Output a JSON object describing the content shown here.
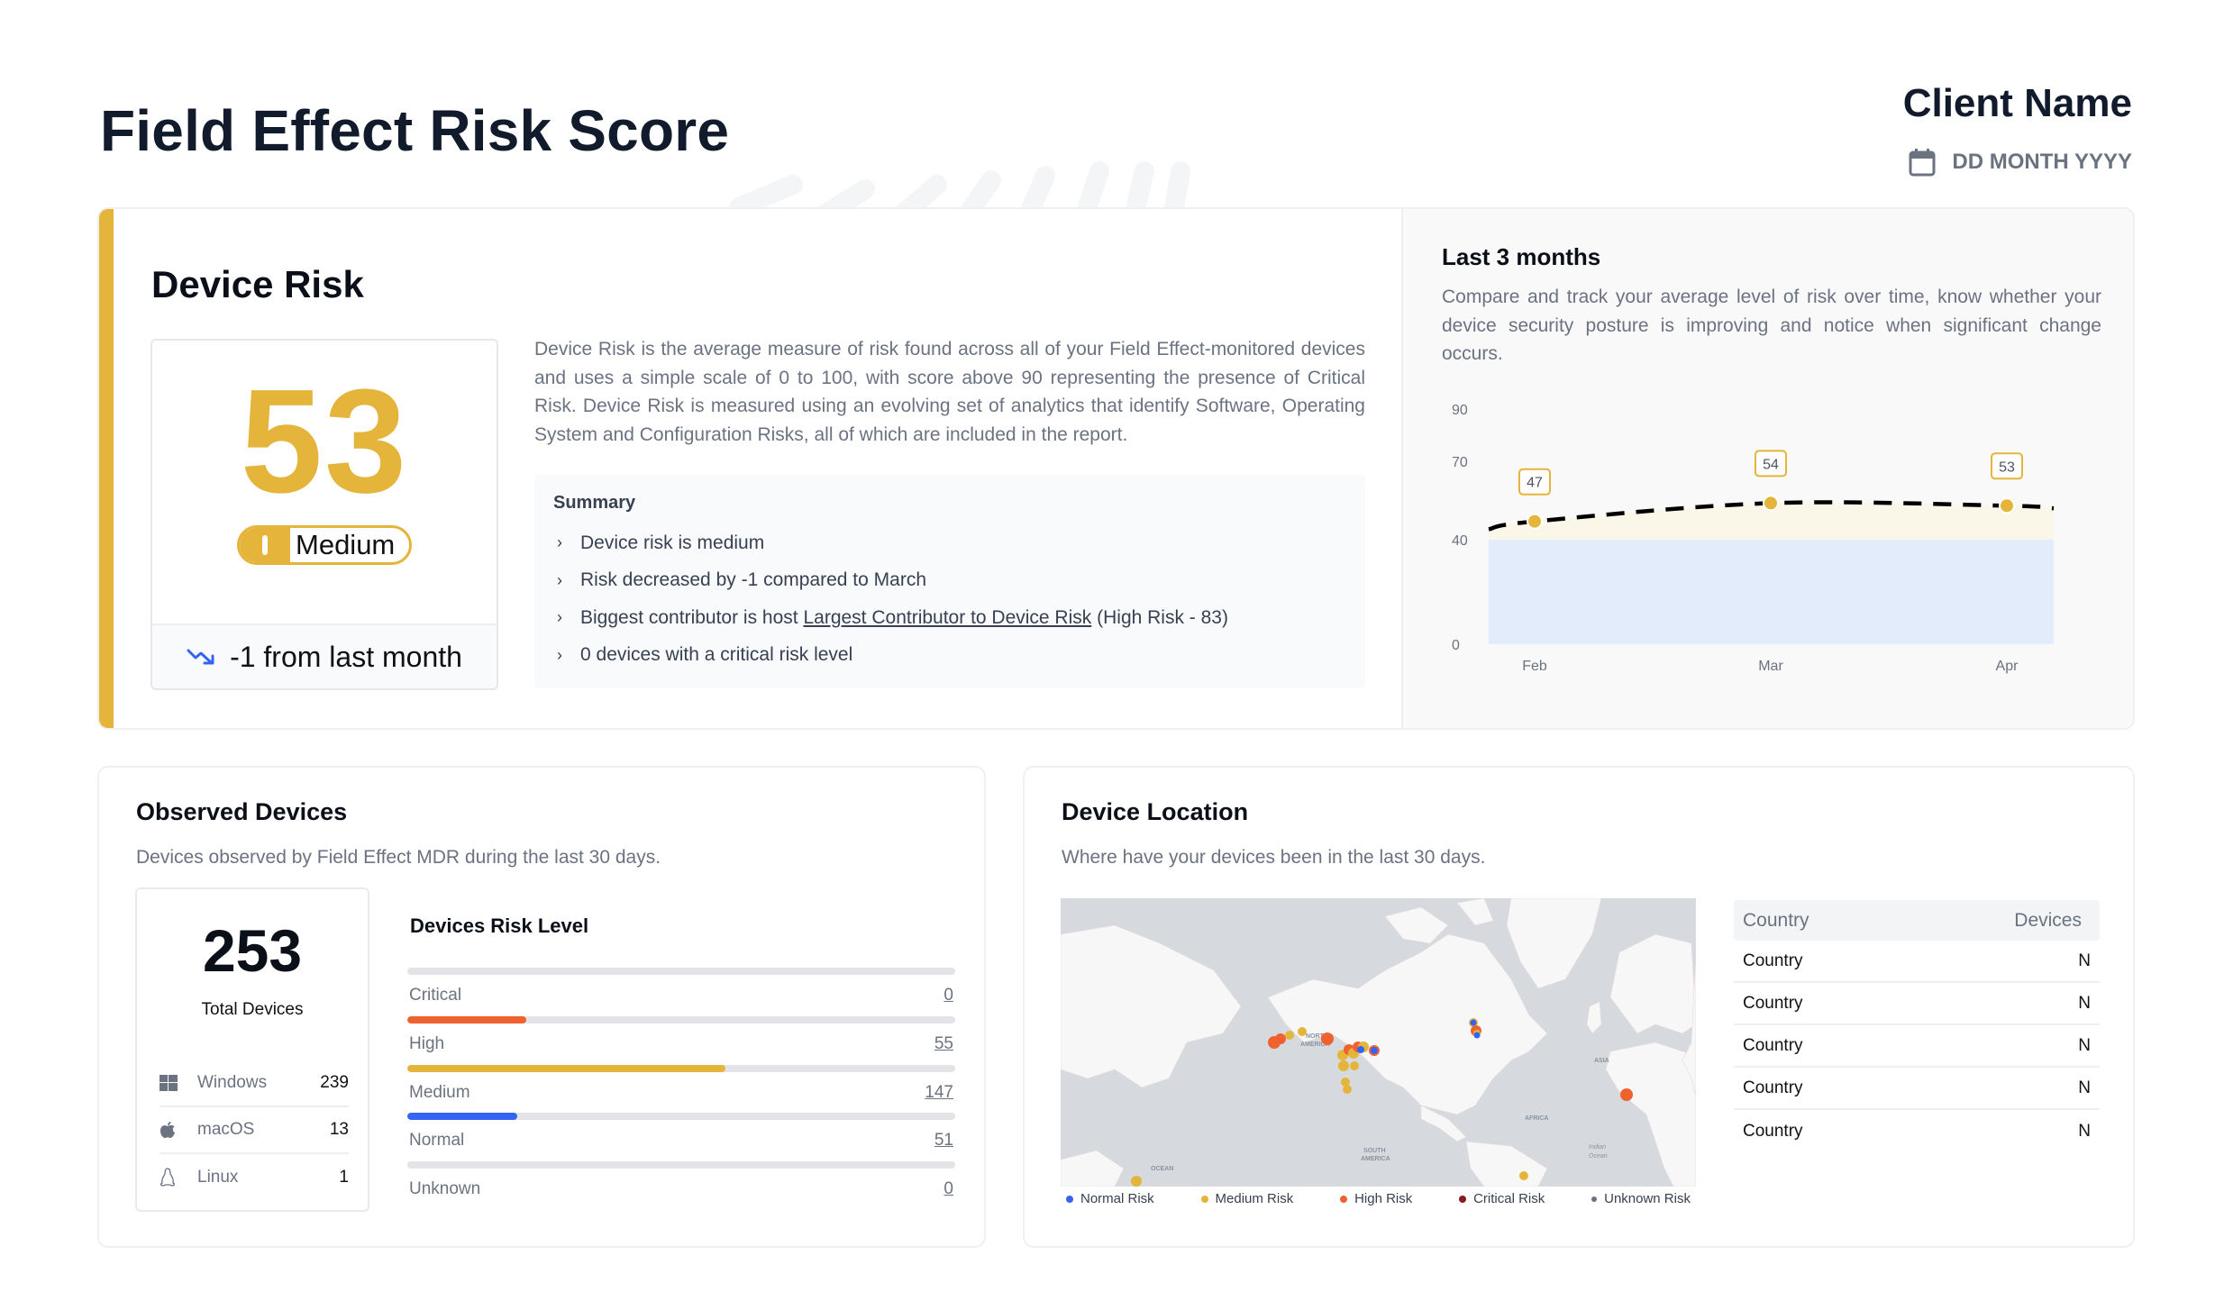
{
  "header": {
    "title": "Field Effect Risk Score",
    "client_name": "Client Name",
    "date": "DD MONTH YYYY",
    "date_icon": "calendar-icon"
  },
  "colors": {
    "accent_gold": "#e5b43a",
    "high_orange": "#f06130",
    "normal_blue": "#3563f3",
    "critical_red": "#8b1a1a",
    "unknown_gray": "#6b7280",
    "band_blue": "#e3ecfb",
    "band_cream": "#faf6e8"
  },
  "device_risk": {
    "title": "Device Risk",
    "score": "53",
    "level": "Medium",
    "trend_icon": "trending-down-icon",
    "change_text": "-1 from last month",
    "description": "Device Risk is the average measure of risk found across all of your Field Effect-monitored devices and uses a simple scale of 0 to 100, with score above 90 representing the presence of Critical Risk. Device Risk is measured using an evolving set of analytics that identify Software, Operating System and Configuration Risks, all of which are included in the report.",
    "summary": {
      "title": "Summary",
      "items": [
        {
          "text": "Device risk is medium"
        },
        {
          "text": "Risk decreased by -1 compared to March"
        },
        {
          "prefix": "Biggest contributor is host ",
          "link": "Largest Contributor to Device Risk",
          "suffix": " (High Risk - 83)"
        },
        {
          "text": "0 devices with a critical risk level"
        }
      ]
    }
  },
  "last_3_months": {
    "title": "Last 3 months",
    "description": "Compare and track your average level of risk over time, know whether your device security posture is improving and notice when significant change occurs."
  },
  "chart_data": {
    "type": "line",
    "title": "Last 3 months",
    "categories": [
      "Feb",
      "Mar",
      "Apr"
    ],
    "series": [
      {
        "name": "Device Risk",
        "values": [
          47,
          54,
          53
        ],
        "style": "dashed",
        "marker_color": "#e5b43a"
      }
    ],
    "data_labels": [
      "47",
      "54",
      "53"
    ],
    "y_ticks": [
      0,
      40,
      70,
      90
    ],
    "y_tick_labels": [
      "0",
      "40",
      "70",
      "90"
    ],
    "ylim": [
      0,
      90
    ],
    "bands": [
      {
        "from": 0,
        "to": 40,
        "label": "normal",
        "color": "#e3ecfb"
      },
      {
        "from": 40,
        "to": "line",
        "label": "medium",
        "color": "#faf6e8"
      }
    ],
    "extends_before_first": 44,
    "extends_after_last": 52,
    "xlabel": "",
    "ylabel": "",
    "grid": false,
    "legend": "none"
  },
  "observed_devices": {
    "title": "Observed Devices",
    "subtitle": "Devices observed by Field Effect MDR during the last 30 days.",
    "total": "253",
    "total_label": "Total Devices",
    "os": [
      {
        "name": "Windows",
        "count": "239",
        "icon": "windows-icon"
      },
      {
        "name": "macOS",
        "count": "13",
        "icon": "apple-icon"
      },
      {
        "name": "Linux",
        "count": "1",
        "icon": "linux-icon"
      }
    ],
    "risk_level_title": "Devices Risk Level",
    "risk_levels": [
      {
        "label": "Critical",
        "value": "0",
        "fraction": 0,
        "color": "#8b1a1a"
      },
      {
        "label": "High",
        "value": "55",
        "fraction": 0.217,
        "color": "#f06130"
      },
      {
        "label": "Medium",
        "value": "147",
        "fraction": 0.581,
        "color": "#e5b43a"
      },
      {
        "label": "Normal",
        "value": "51",
        "fraction": 0.2,
        "color": "#3563f3"
      },
      {
        "label": "Unknown",
        "value": "0",
        "fraction": 0,
        "color": "#6b7280"
      }
    ]
  },
  "device_location": {
    "title": "Device Location",
    "subtitle": "Where have your devices been in the last 30 days.",
    "map_labels": [
      "NORTH AMERICA",
      "SOUTH AMERICA",
      "AFRICA",
      "ASIA",
      "OCEAN",
      "Indian Ocean"
    ],
    "legend": [
      {
        "label": "Normal Risk",
        "color": "#3563f3"
      },
      {
        "label": "Medium Risk",
        "color": "#e5b43a"
      },
      {
        "label": "High Risk",
        "color": "#f06130"
      },
      {
        "label": "Critical Risk",
        "color": "#8b1a1a"
      },
      {
        "label": "Unknown Risk",
        "color": "#6b7280"
      }
    ],
    "table": {
      "headers": [
        "Country",
        "Devices"
      ],
      "rows": [
        [
          "Country",
          "N"
        ],
        [
          "Country",
          "N"
        ],
        [
          "Country",
          "N"
        ],
        [
          "Country",
          "N"
        ],
        [
          "Country",
          "N"
        ]
      ]
    }
  }
}
